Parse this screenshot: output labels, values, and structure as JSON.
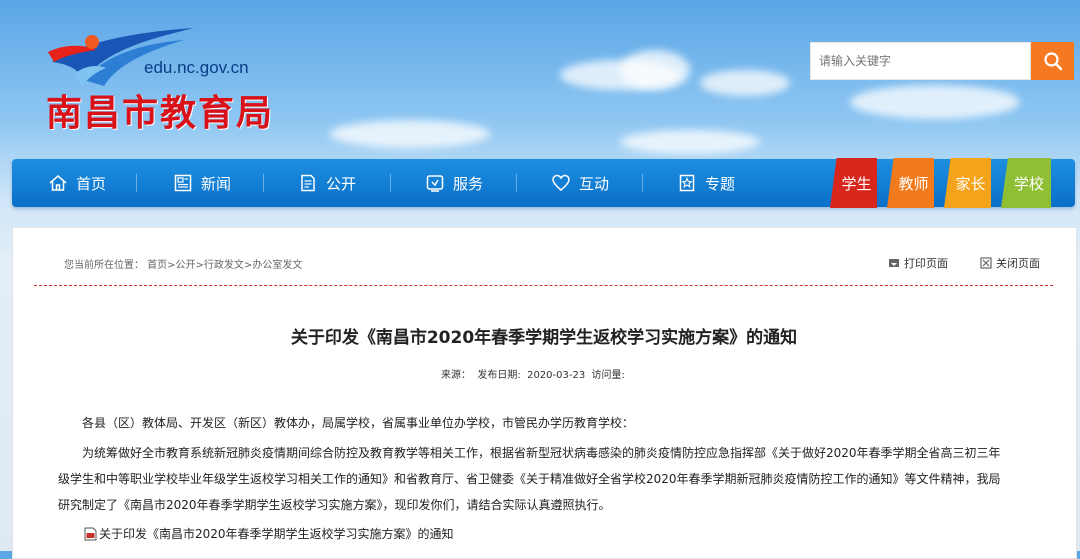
{
  "header": {
    "site_url": "edu.nc.gov.cn",
    "site_name": "南昌市教育局"
  },
  "search": {
    "placeholder": "请输入关键字"
  },
  "nav": {
    "items": [
      {
        "label": "首页",
        "icon": "home-icon"
      },
      {
        "label": "新闻",
        "icon": "news-icon"
      },
      {
        "label": "公开",
        "icon": "document-icon"
      },
      {
        "label": "服务",
        "icon": "service-icon"
      },
      {
        "label": "互动",
        "icon": "heart-icon"
      },
      {
        "label": "专题",
        "icon": "star-badge-icon"
      }
    ],
    "roles": [
      {
        "label": "学生",
        "color": "#d9261c"
      },
      {
        "label": "教师",
        "color": "#f07a1c"
      },
      {
        "label": "家长",
        "color": "#f5a31a"
      },
      {
        "label": "学校",
        "color": "#8fbf34"
      }
    ]
  },
  "breadcrumb": "您当前所在位置： 首页>公开>行政发文>办公室发文",
  "tools": {
    "print": "打印页面",
    "close": "关闭页面"
  },
  "article": {
    "title": "关于印发《南昌市2020年春季学期学生返校学习实施方案》的通知",
    "meta": "来源：  发布日期:  2020-03-23  访问量:",
    "salutation": "各县（区）教体局、开发区（新区）教体办，局属学校，省属事业单位办学校，市管民办学历教育学校：",
    "body_line1": "为统筹做好全市教育系统新冠肺炎疫情期间综合防控及教育教学等相关工作，根据省新型冠状病毒感染的肺炎疫情防控应急指挥部《关于做好2020年春季学期全省高三初三年",
    "body_line2": "级学生和中等职业学校毕业年级学生返校学习相关工作的通知》和省教育厅、省卫健委《关于精准做好全省学校2020年春季学期新冠肺炎疫情防控工作的通知》等文件精神，我局",
    "body_line3": "研究制定了《南昌市2020年春季学期学生返校学习实施方案》，现印发你们，请结合实际认真遵照执行。",
    "attachment": "关于印发《南昌市2020年春季学期学生返校学习实施方案》的通知"
  }
}
